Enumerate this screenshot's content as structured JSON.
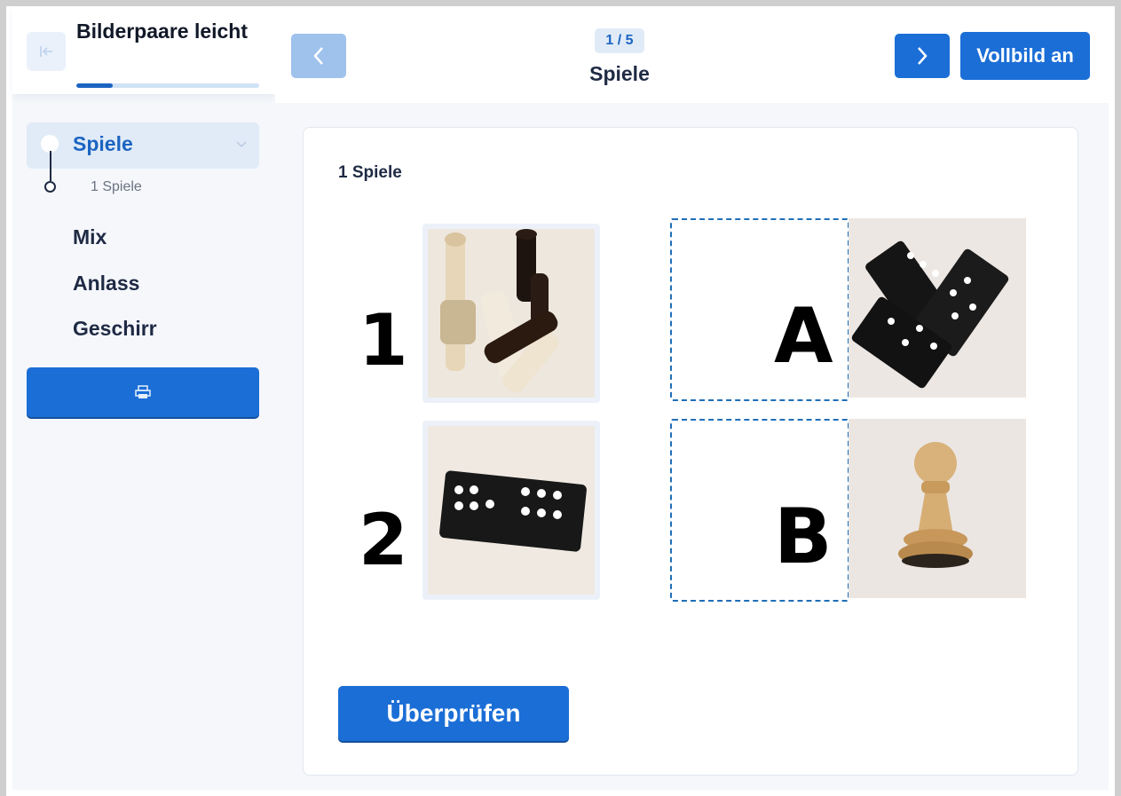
{
  "sidebar": {
    "title": "Bilderpaare leicht",
    "progress": 0.2,
    "active_item": {
      "label": "Spiele",
      "sub_item": "1 Spiele"
    },
    "items": [
      {
        "label": "Mix"
      },
      {
        "label": "Anlass"
      },
      {
        "label": "Geschirr"
      }
    ],
    "print_icon": "print-icon",
    "collapse_icon": "collapse-left-icon"
  },
  "topbar": {
    "counter": "1 / 5",
    "title": "Spiele",
    "fullscreen_label": "Vollbild an",
    "prev_icon": "chevron-left-icon",
    "next_icon": "chevron-right-icon"
  },
  "exercise": {
    "title": "1 Spiele",
    "left_items": [
      {
        "number": "1",
        "image": "chess-pieces-photo"
      },
      {
        "number": "2",
        "image": "domino-tile-photo"
      }
    ],
    "right_items": [
      {
        "letter": "A",
        "image": "domino-pile-photo"
      },
      {
        "letter": "B",
        "image": "wooden-pawn-photo"
      }
    ],
    "check_label": "Überprüfen"
  },
  "colors": {
    "accent": "#1b6ed6",
    "accent_light": "#9fc2ec",
    "active_bg": "#e0ebf7",
    "dropzone_border": "#1f6fb8"
  }
}
